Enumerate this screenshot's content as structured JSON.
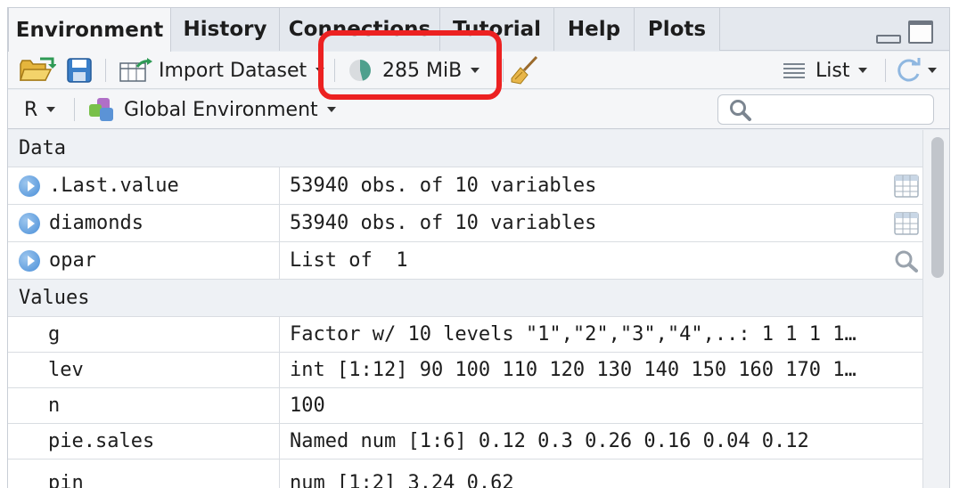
{
  "tabs": [
    {
      "label": "Environment",
      "active": true
    },
    {
      "label": "History"
    },
    {
      "label": "Connections"
    },
    {
      "label": "Tutorial"
    },
    {
      "label": "Help"
    },
    {
      "label": "Plots"
    }
  ],
  "toolbar": {
    "import_label": "Import Dataset",
    "memory_label": "285 MiB",
    "view_mode": "List"
  },
  "env_bar": {
    "language": "R",
    "environment": "Global Environment",
    "search_placeholder": ""
  },
  "sections": {
    "data": "Data",
    "values": "Values"
  },
  "data_rows": [
    {
      "name": ".Last.value",
      "value": "53940 obs. of 10 variables",
      "action": "table-view-icon"
    },
    {
      "name": "diamonds",
      "value": "53940 obs. of 10 variables",
      "action": "table-view-icon"
    },
    {
      "name": "opar",
      "value": "List of  1",
      "action": "magnifier-icon"
    }
  ],
  "value_rows": [
    {
      "name": "g",
      "value": "Factor w/ 10 levels \"1\",\"2\",\"3\",\"4\",..: 1 1 1 1…"
    },
    {
      "name": "lev",
      "value": "int [1:12] 90 100 110 120 130 140 150 160 170 1…"
    },
    {
      "name": "n",
      "value": "100"
    },
    {
      "name": "pie.sales",
      "value": "Named num [1:6] 0.12 0.3 0.26 0.16 0.04 0.12"
    },
    {
      "name": "pin",
      "value": "num [1:2] 3.24 0.62"
    }
  ],
  "colors": {
    "highlight": "#ec2121",
    "expand_icon": "#4a8fd8"
  }
}
